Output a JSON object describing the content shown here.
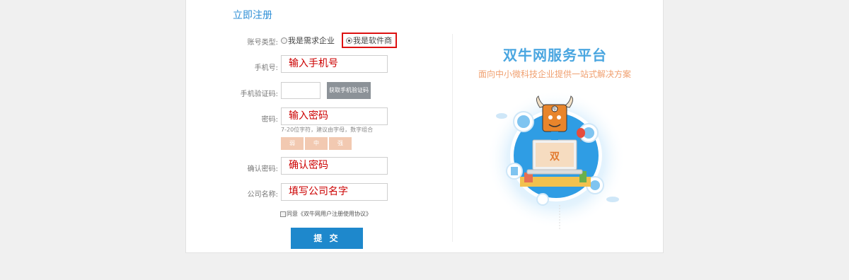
{
  "form": {
    "title": "立即注册",
    "account_type_label": "账号类型:",
    "radio_buyer": "我是需求企业",
    "radio_vendor": "我是软件商",
    "phone_label": "手机号:",
    "phone_value": "输入手机号",
    "sms_label": "手机验证码:",
    "sms_value": "",
    "sms_button": "获取手机验证码",
    "password_label": "密码:",
    "password_value": "输入密码",
    "password_hint": "7-20位字符，建议由字母，数字组合",
    "strength_weak": "弱",
    "strength_medium": "中",
    "strength_strong": "强",
    "confirm_label": "确认密码:",
    "confirm_value": "确认密码",
    "company_label": "公司名称:",
    "company_value": "填写公司名字",
    "agree_text": "同意《双牛网用户注册使用协议》",
    "submit": "提 交"
  },
  "promo": {
    "brand": "双牛网服务平台",
    "tagline": "面向中小微科技企业提供一站式解决方案",
    "mascot_badge": "牛",
    "screen_logo": "双"
  },
  "colors": {
    "accent": "#1e88cc",
    "highlight_border": "#dd1111",
    "value_text": "#cc0000",
    "brand": "#4aa6e0",
    "tagline": "#f0a070",
    "strength": "#f2c9b1"
  }
}
